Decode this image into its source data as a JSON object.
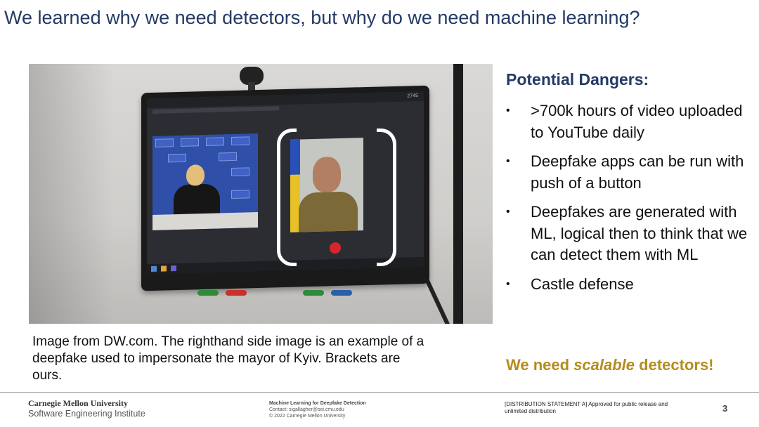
{
  "slide": {
    "title": "We learned why we need detectors, but why do we need machine learning?"
  },
  "photo": {
    "screen_clock": "2745",
    "alt_description_icon": "video-call-photo"
  },
  "caption": {
    "text": "Image from DW.com. The righthand side image is an example of a deepfake used to impersonate the mayor of Kyiv. Brackets are ours."
  },
  "right_panel": {
    "heading": "Potential Dangers:",
    "bullets": [
      ">700k hours of video uploaded to YouTube daily",
      "Deepfake apps can be run with push of a button",
      "Deepfakes are generated with ML, logical then to think that we can detect them with ML",
      "Castle defense"
    ],
    "bullet_symbol": "•",
    "conclusion_prefix": "We need ",
    "conclusion_emphasis": "scalable",
    "conclusion_suffix": " detectors!",
    "conclusion_color": "#b38d1e"
  },
  "footer": {
    "university": "Carnegie Mellon University",
    "institute": "Software Engineering Institute",
    "course_title": "Machine Learning for Deepfake Detection",
    "contact": "Contact: sigallagher@sei.cmu.edu",
    "copyright": "© 2022 Carnegie Mellon University",
    "distribution": "[DISTRIBUTION STATEMENT A] Approved for public release and unlimited distribution",
    "page_number": "3"
  },
  "colors": {
    "title": "#243a66",
    "flag_blue": "#2850b8",
    "flag_yellow": "#e8c126"
  }
}
